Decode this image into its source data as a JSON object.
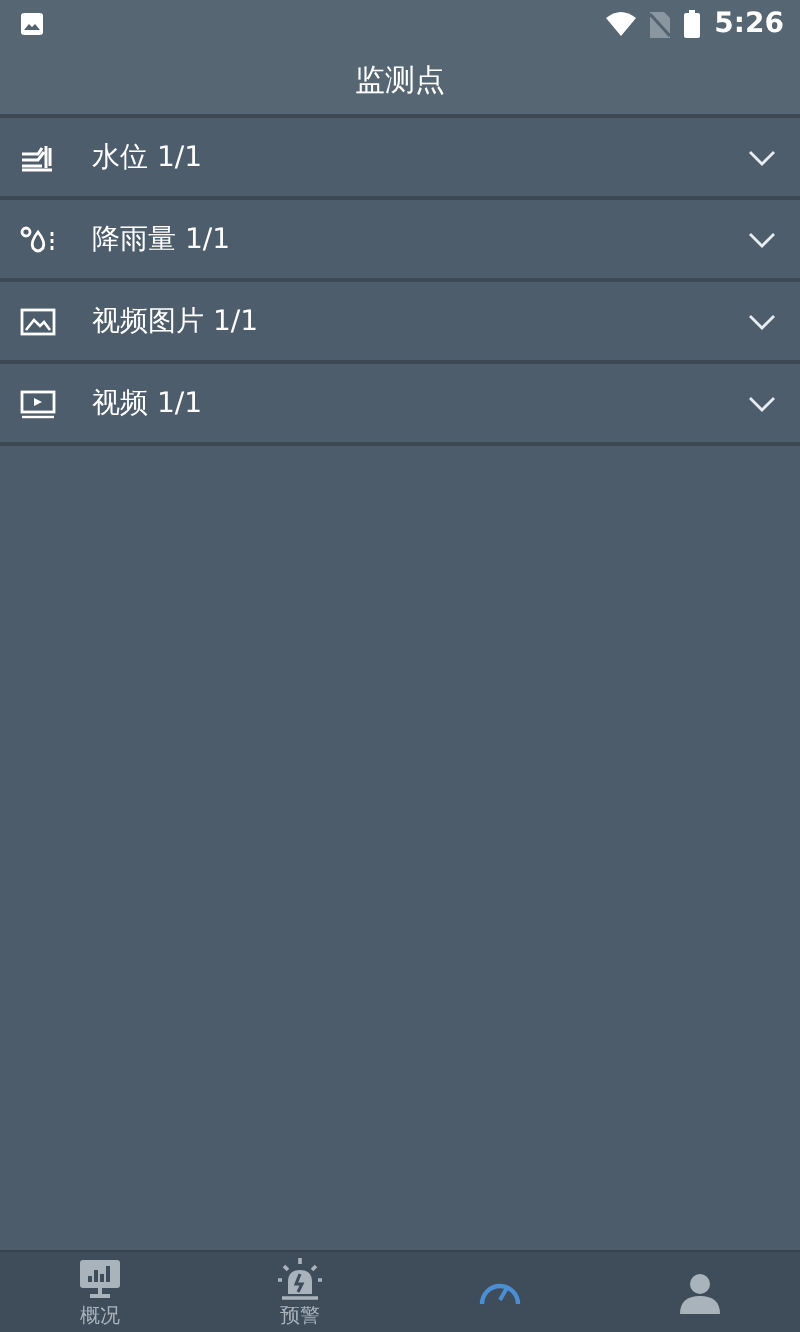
{
  "status_bar": {
    "time": "5:26"
  },
  "header": {
    "title": "监测点"
  },
  "sections": [
    {
      "kind": "water",
      "label": "水位 1/1",
      "expanded": false
    },
    {
      "kind": "rain",
      "label": "降雨量 1/1",
      "expanded": false
    },
    {
      "kind": "image",
      "label": "视频图片 1/1",
      "expanded": false
    },
    {
      "kind": "video",
      "label": "视频 1/1",
      "expanded": false
    }
  ],
  "tab_bar": [
    {
      "kind": "overview",
      "label": "概况",
      "selected": false
    },
    {
      "kind": "alert",
      "label": "预警",
      "selected": false
    },
    {
      "kind": "gauge",
      "selected": true
    },
    {
      "kind": "person",
      "selected": false
    }
  ]
}
